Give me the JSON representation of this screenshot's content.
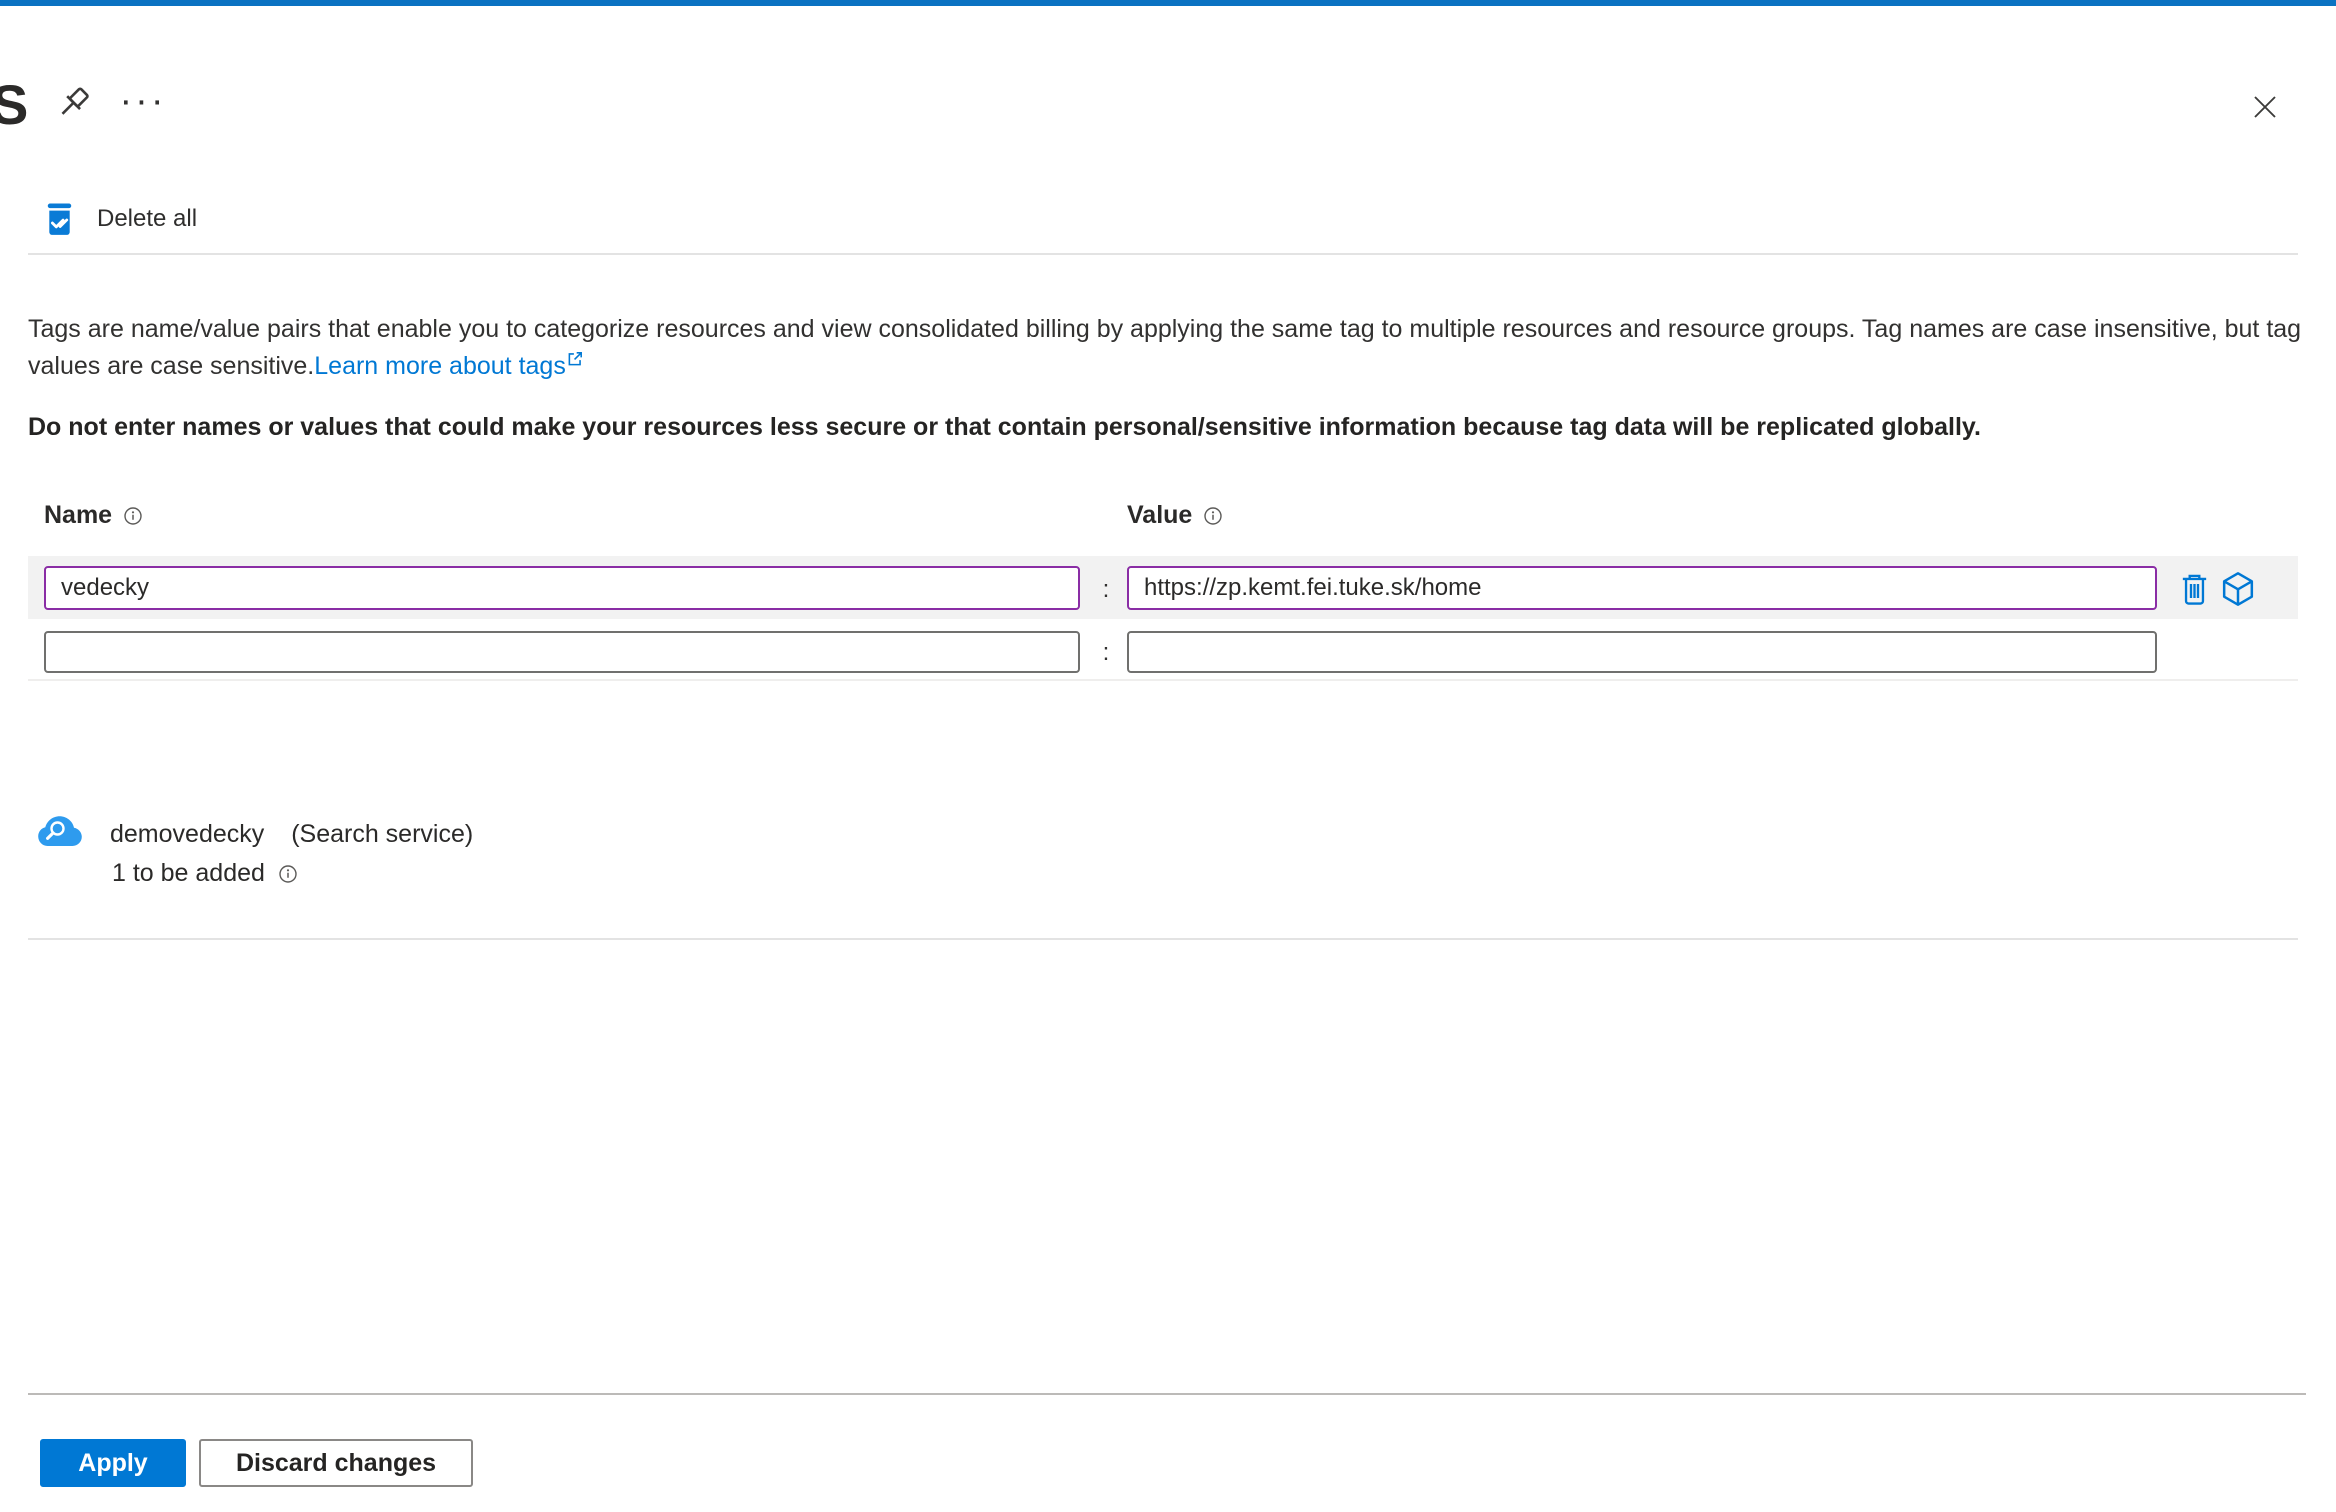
{
  "header": {
    "partial_title": "S"
  },
  "icons": {
    "more": "···",
    "close": "✕",
    "pin": "pushpin-icon",
    "delete_all": "trash-checkmark-icon",
    "external_link": "box-arrow-icon",
    "info": "info-circle-icon",
    "delete_row": "trash-icon",
    "apply_to_resource_group": "cube-icon",
    "resource": "cloud-search-icon"
  },
  "toolbar": {
    "delete_all_label": "Delete all"
  },
  "description": {
    "text": "Tags are name/value pairs that enable you to categorize resources and view consolidated billing by applying the same tag to multiple resources and resource groups. Tag names are case insensitive, but tag values are case sensitive.",
    "link_label": "Learn more about tags",
    "warning": "Do not enter names or values that could make your resources less secure or that contain personal/sensitive information because tag data will be replicated globally."
  },
  "tags_editor": {
    "name_header": "Name",
    "value_header": "Value",
    "separator": ":",
    "rows": [
      {
        "name": "vedecky",
        "value": "https://zp.kemt.fei.tuke.sk/home"
      },
      {
        "name": "",
        "value": ""
      }
    ]
  },
  "resource": {
    "name": "demovedecky",
    "type_label": "(Search service)",
    "status": "1 to be added"
  },
  "footer": {
    "apply_label": "Apply",
    "discard_label": "Discard changes"
  },
  "colors": {
    "accent": "#0078d4",
    "top_bar": "#0b72c2",
    "modified_border": "#8a2da5",
    "empty_border": "#70706e",
    "row_highlight": "#f2f2f2",
    "text": "#323130"
  }
}
